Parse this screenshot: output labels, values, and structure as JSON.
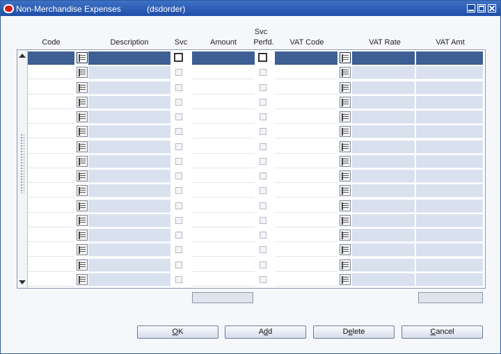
{
  "window": {
    "title": "Non-Merchandise Expenses",
    "subtitle": "(dsdorder)",
    "controls": [
      "minimize-icon",
      "maximize-icon",
      "close-icon"
    ]
  },
  "table": {
    "headers": {
      "code": "Code",
      "description": "Description",
      "svc": "Svc",
      "amount": "Amount",
      "svc_perfd_1": "Svc",
      "svc_perfd_2": "Perfd.",
      "vat_code": "VAT Code",
      "vat_rate": "VAT Rate",
      "vat_amt": "VAT Amt"
    },
    "row_count": 16,
    "selected_row": 0
  },
  "buttons": {
    "ok": {
      "pre": "",
      "ul": "O",
      "post": "K"
    },
    "add": {
      "pre": "A",
      "ul": "d",
      "post": "d"
    },
    "delete": {
      "pre": "D",
      "ul": "e",
      "post": "lete"
    },
    "cancel": {
      "pre": "",
      "ul": "C",
      "post": "ancel"
    }
  },
  "colors": {
    "title_bar": "#1f4ea8",
    "selected_row": "#3e5f93",
    "readonly_cell": "#d9e1ef"
  }
}
